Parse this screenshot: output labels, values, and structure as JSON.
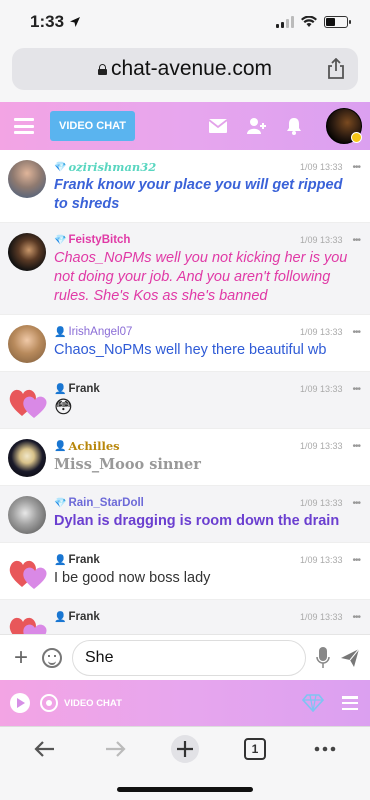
{
  "status": {
    "time": "1:33"
  },
  "browser": {
    "url": "chat-avenue.com",
    "tab_count": "1"
  },
  "header": {
    "video_chat_label": "VIDEO CHAT"
  },
  "messages": [
    {
      "user": "ozirishman32",
      "rank": "diamond",
      "time": "1/09 13:33",
      "more": "•••",
      "text": "Frank know your place you will get ripped to shreds",
      "name_color": "#59d6c0",
      "text_color": "#3a62d8"
    },
    {
      "user": "FeistyBitch",
      "rank": "diamond",
      "time": "1/09 13:33",
      "more": "•••",
      "text": "Chaos_NoPMs well you not kicking her is you not doing your job. And you aren't following rules. She's Kos as she's banned",
      "name_color": "#e03aa6",
      "text_color": "#e03aa6"
    },
    {
      "user": "IrishAngel07",
      "rank": "user",
      "time": "1/09 13:33",
      "more": "•••",
      "text": "Chaos_NoPMs well hey there beautiful wb",
      "name_color": "#8a6cd6",
      "text_color": "#2f5bd6"
    },
    {
      "user": "Frank",
      "rank": "user",
      "time": "1/09 13:33",
      "more": "•••",
      "text": "😳",
      "name_color": "#333333",
      "text_color": "#333333"
    },
    {
      "user": "Achilles",
      "rank": "user",
      "time": "1/09 13:33",
      "more": "•••",
      "text": "Miss_Mooo sinner",
      "name_color": "#b8860b",
      "text_color": "#999999"
    },
    {
      "user": "Rain_StarDoll",
      "rank": "diamond",
      "time": "1/09 13:33",
      "more": "•••",
      "text": "Dylan is dragging is room down the drain",
      "name_color": "#6d6ad8",
      "text_color": "#6b3fd0"
    },
    {
      "user": "Frank",
      "rank": "user",
      "time": "1/09 13:33",
      "more": "•••",
      "text": "I be good now boss lady",
      "name_color": "#333333",
      "text_color": "#333333"
    },
    {
      "user": "Frank",
      "rank": "user",
      "time": "1/09 13:33",
      "more": "•••",
      "text": "",
      "name_color": "#333333",
      "text_color": "#333333"
    }
  ],
  "composer": {
    "value": "She"
  },
  "bottom_bar": {
    "video_chat_label": "VIDEO CHAT"
  }
}
